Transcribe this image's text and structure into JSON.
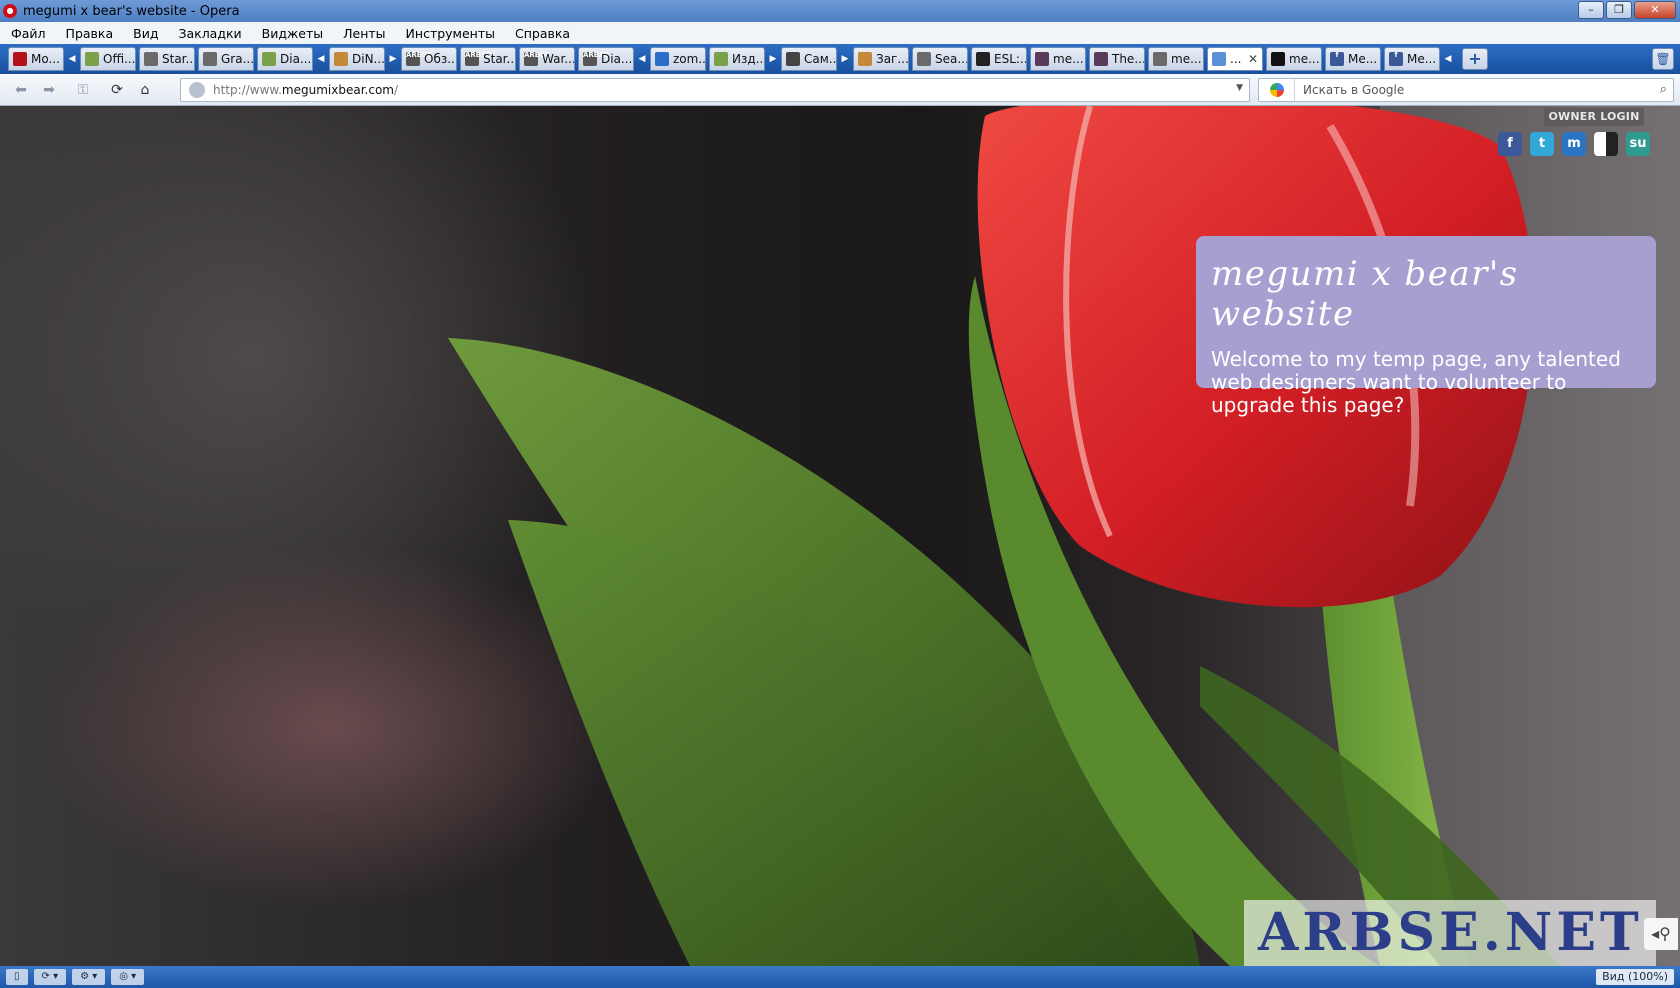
{
  "window": {
    "title": "megumi x bear's website - Opera",
    "min": "–",
    "max": "❐",
    "close": "✕"
  },
  "menu": [
    "Файл",
    "Правка",
    "Вид",
    "Закладки",
    "Виджеты",
    "Ленты",
    "Инструменты",
    "Справка"
  ],
  "tabs": [
    {
      "label": "Mo...",
      "icon": "opera-icon"
    },
    {
      "label": "Offi...",
      "icon": "page-icon"
    },
    {
      "label": "Star...",
      "icon": "wiki-icon"
    },
    {
      "label": "Gra...",
      "icon": "wiki-icon"
    },
    {
      "label": "Dia...",
      "icon": "page-icon"
    },
    {
      "label": "DiN...",
      "icon": "page-icon"
    },
    {
      "label": "Обз...",
      "icon": "arbse-icon"
    },
    {
      "label": "Star...",
      "icon": "arbse-icon"
    },
    {
      "label": "War...",
      "icon": "arbse-icon"
    },
    {
      "label": "Dia...",
      "icon": "arbse-icon"
    },
    {
      "label": "zom...",
      "icon": "image-icon"
    },
    {
      "label": "Изд...",
      "icon": "page-icon"
    },
    {
      "label": "Сам...",
      "icon": "edit-icon"
    },
    {
      "label": "Заг...",
      "icon": "download-icon"
    },
    {
      "label": "Sea...",
      "icon": "wiki-icon"
    },
    {
      "label": "ESL:...",
      "icon": "esl-icon"
    },
    {
      "label": "me...",
      "icon": "site-icon"
    },
    {
      "label": "The...",
      "icon": "site-icon"
    },
    {
      "label": "me...",
      "icon": "wiki-icon"
    },
    {
      "label": "...",
      "icon": "page-icon",
      "active": true
    },
    {
      "label": "me...",
      "icon": "site-icon"
    },
    {
      "label": "Me...",
      "icon": "facebook-icon"
    },
    {
      "label": "Me...",
      "icon": "facebook-icon"
    }
  ],
  "address": {
    "url_prefix": "http://www.",
    "url_host": "megumixbear.com",
    "url_suffix": "/"
  },
  "search": {
    "placeholder": "Искать в Google"
  },
  "page": {
    "owner_login": "OWNER LOGIN",
    "site_title": "megumi x bear's website",
    "welcome_text": "Welcome to my temp page, any talented web designers want to volunteer to upgrade this page?",
    "watermark": "ARBSE.NET",
    "social": [
      {
        "name": "facebook",
        "glyph": "f"
      },
      {
        "name": "twitter",
        "glyph": "t"
      },
      {
        "name": "myspace",
        "glyph": "m"
      },
      {
        "name": "delicious",
        "glyph": ""
      },
      {
        "name": "stumbleupon",
        "glyph": "su"
      }
    ]
  },
  "status": {
    "zoom": "Вид (100%)"
  },
  "colors": {
    "panel": "#a89fd1",
    "tulip": "#d8262a",
    "leaf": "#4f7a2c"
  }
}
